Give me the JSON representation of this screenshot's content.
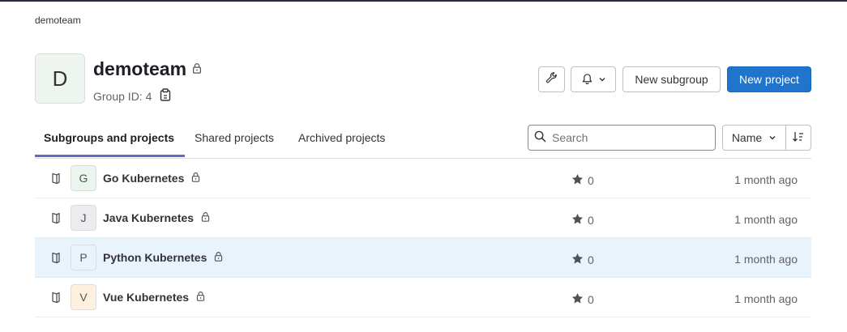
{
  "breadcrumb": "demoteam",
  "group": {
    "avatar_letter": "D",
    "name": "demoteam",
    "id_text": "Group ID: 4"
  },
  "actions": {
    "new_subgroup": "New subgroup",
    "new_project": "New project"
  },
  "tabs": [
    {
      "label": "Subgroups and projects",
      "active": true
    },
    {
      "label": "Shared projects",
      "active": false
    },
    {
      "label": "Archived projects",
      "active": false
    }
  ],
  "search": {
    "placeholder": "Search"
  },
  "sort": {
    "label": "Name"
  },
  "projects": [
    {
      "letter": "G",
      "name": "Go Kubernetes",
      "stars": "0",
      "updated": "1 month ago",
      "avatar_color": "#ecf4ee"
    },
    {
      "letter": "J",
      "name": "Java Kubernetes",
      "stars": "0",
      "updated": "1 month ago",
      "avatar_color": "#ececef"
    },
    {
      "letter": "P",
      "name": "Python Kubernetes",
      "stars": "0",
      "updated": "1 month ago",
      "avatar_color": "#e9f3fc"
    },
    {
      "letter": "V",
      "name": "Vue Kubernetes",
      "stars": "0",
      "updated": "1 month ago",
      "avatar_color": "#fdf1dd"
    }
  ],
  "colors": {
    "primary": "#1f75cb",
    "tab_underline": "#6666c4",
    "highlight_row": "#e9f3fc"
  },
  "icons": [
    "lock-icon",
    "clipboard-icon",
    "wrench-icon",
    "bell-icon",
    "chevron-down-icon",
    "search-icon",
    "sort-direction-icon",
    "book-icon",
    "star-icon"
  ]
}
